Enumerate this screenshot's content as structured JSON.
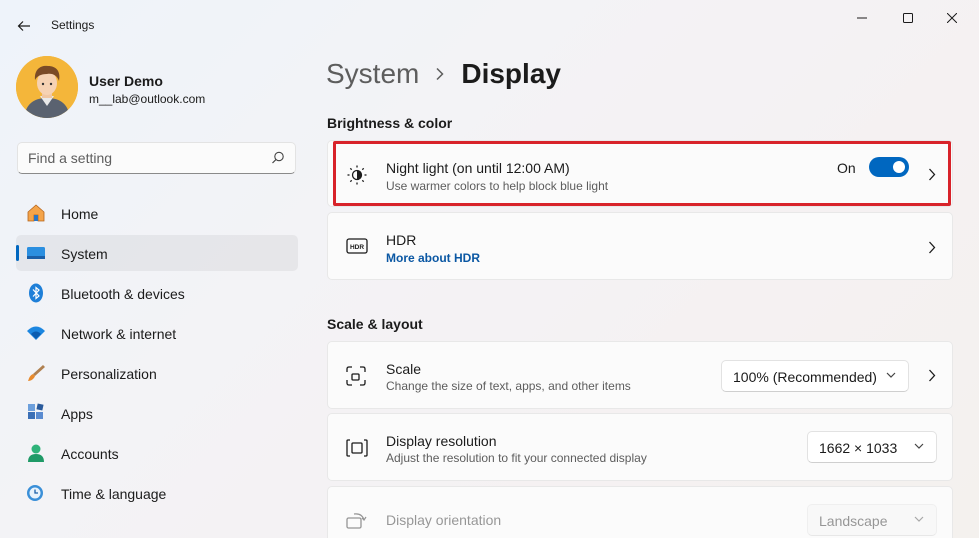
{
  "window": {
    "app_title": "Settings",
    "icons": [
      "back-icon",
      "minimize-icon",
      "maximize-icon",
      "close-icon"
    ]
  },
  "profile": {
    "name": "User Demo",
    "email": "m__lab@outlook.com"
  },
  "search": {
    "placeholder": "Find a setting"
  },
  "sidebar": {
    "items": [
      {
        "label": "Home",
        "icon": "home-icon"
      },
      {
        "label": "System",
        "icon": "system-icon",
        "active": true
      },
      {
        "label": "Bluetooth & devices",
        "icon": "bluetooth-icon"
      },
      {
        "label": "Network & internet",
        "icon": "wifi-icon"
      },
      {
        "label": "Personalization",
        "icon": "brush-icon"
      },
      {
        "label": "Apps",
        "icon": "apps-icon"
      },
      {
        "label": "Accounts",
        "icon": "accounts-icon"
      },
      {
        "label": "Time & language",
        "icon": "clock-globe-icon"
      }
    ]
  },
  "breadcrumb": {
    "parent": "System",
    "current": "Display"
  },
  "sections": {
    "brightness": {
      "title": "Brightness & color",
      "night_light": {
        "title": "Night light (on until 12:00 AM)",
        "description": "Use warmer colors to help block blue light",
        "toggle_label": "On",
        "toggle_on": true
      },
      "hdr": {
        "title": "HDR",
        "link": "More about HDR"
      }
    },
    "scale_layout": {
      "title": "Scale & layout",
      "scale": {
        "title": "Scale",
        "description": "Change the size of text, apps, and other items",
        "value": "100% (Recommended)"
      },
      "resolution": {
        "title": "Display resolution",
        "description": "Adjust the resolution to fit your connected display",
        "value": "1662 × 1033"
      },
      "orientation": {
        "title": "Display orientation",
        "value": "Landscape"
      }
    }
  },
  "colors": {
    "accent": "#0067c0",
    "highlight_border": "#d8232a"
  }
}
